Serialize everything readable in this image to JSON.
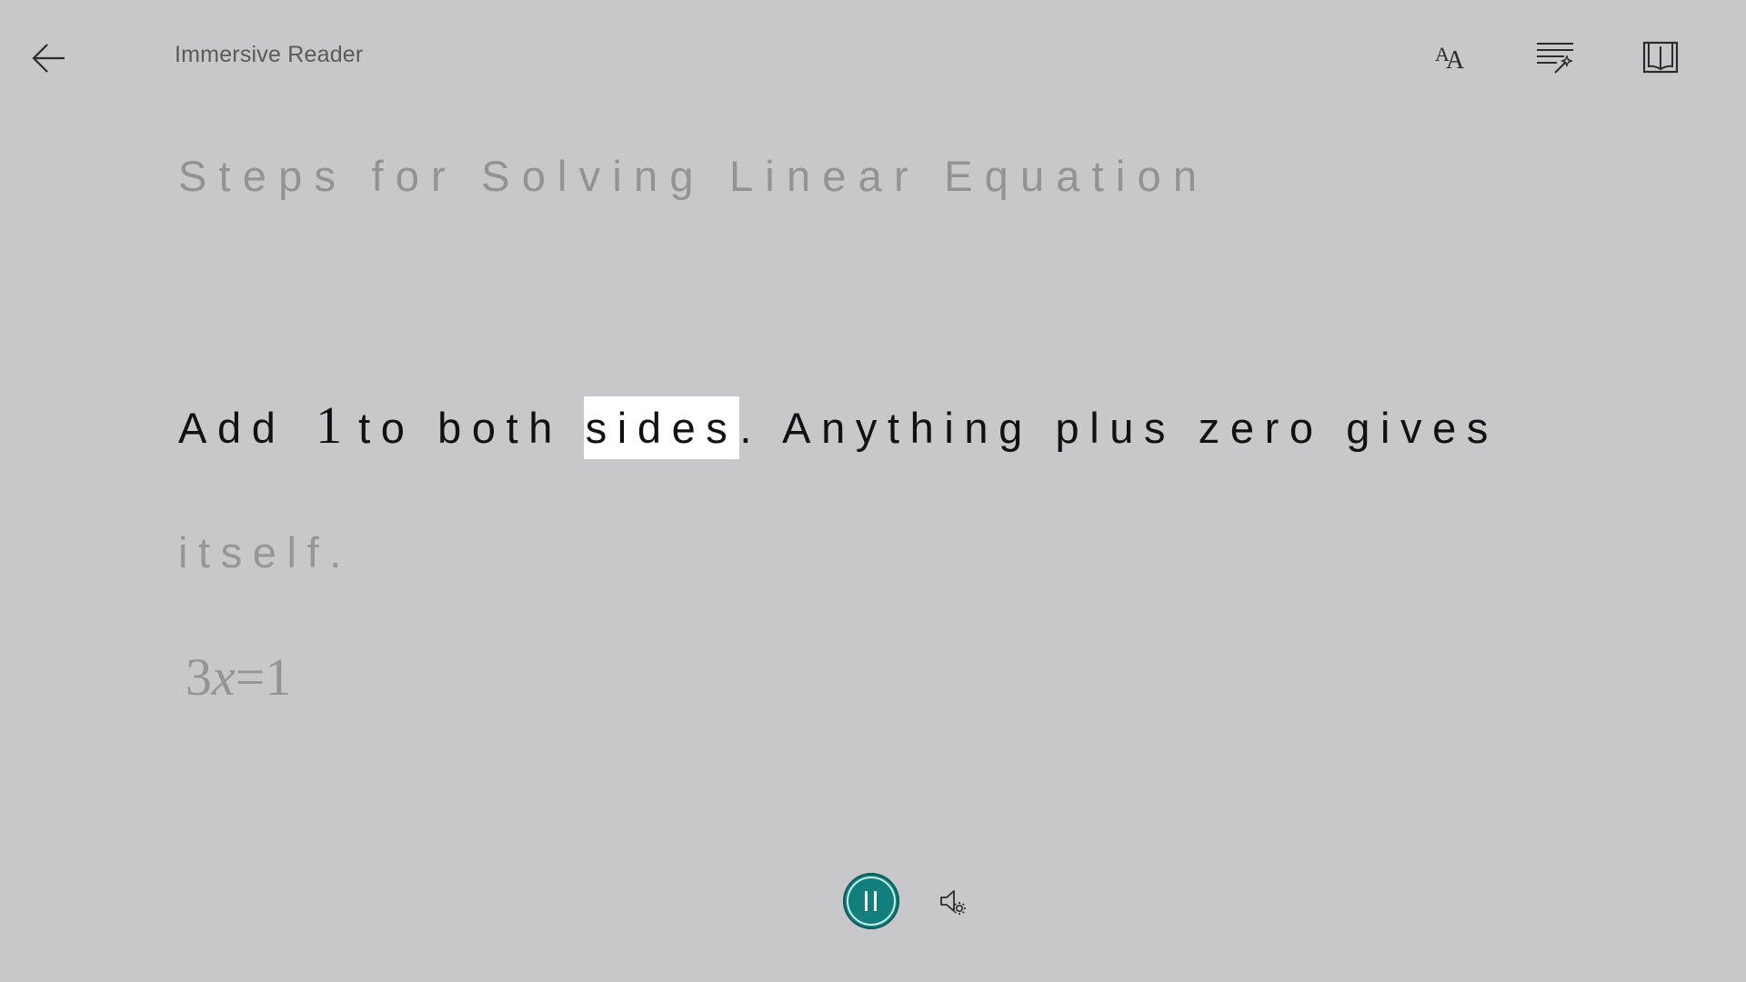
{
  "header": {
    "title": "Immersive Reader",
    "back_icon": "arrow-left-icon",
    "toolbar": [
      {
        "name": "text-preferences",
        "icon": "text-size-icon"
      },
      {
        "name": "grammar-options",
        "icon": "grammar-wand-icon"
      },
      {
        "name": "reading-preferences",
        "icon": "open-book-icon"
      }
    ]
  },
  "document": {
    "heading": "Steps for Solving Linear Equation",
    "active_line": {
      "before": "Add ",
      "number": "1",
      "middle": "to both ",
      "highlighted_word": "sides",
      "after": ". Anything plus zero gives"
    },
    "next_line": "itself.",
    "math": {
      "coefficient": "3",
      "variable": "x",
      "equals": "=",
      "value": "1"
    }
  },
  "playback": {
    "state": "playing",
    "play_button_icon": "pause-icon",
    "voice_settings_icon": "voice-settings-icon"
  },
  "colors": {
    "background": "#c8c8ca",
    "accent": "#137f7c",
    "highlight": "#ffffff",
    "active_text": "#111111",
    "dim_text": "#969698"
  }
}
